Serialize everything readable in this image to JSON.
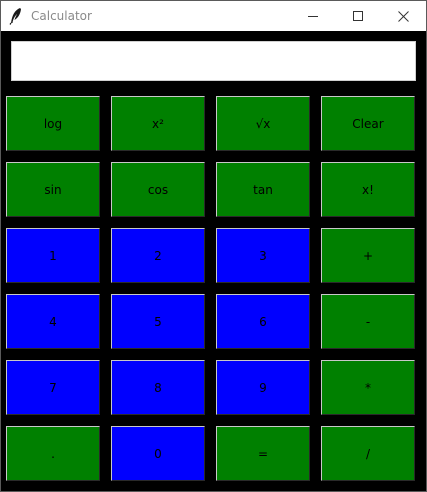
{
  "window": {
    "title": "Calculator",
    "icon": "feather-icon",
    "controls": {
      "minimize": "minimize-icon",
      "maximize": "maximize-icon",
      "close": "close-icon"
    }
  },
  "display": {
    "value": ""
  },
  "colors": {
    "function_key": "#008000",
    "digit_key": "#0000ff",
    "background": "#000000"
  },
  "keys": {
    "log": "log",
    "square": "x²",
    "sqrt": "√x",
    "clear": "Clear",
    "sin": "sin",
    "cos": "cos",
    "tan": "tan",
    "factorial": "x!",
    "one": "1",
    "two": "2",
    "three": "3",
    "plus": "+",
    "four": "4",
    "five": "5",
    "six": "6",
    "minus": "-",
    "seven": "7",
    "eight": "8",
    "nine": "9",
    "multiply": "*",
    "dot": ".",
    "zero": "0",
    "equals": "=",
    "divide": "/"
  }
}
